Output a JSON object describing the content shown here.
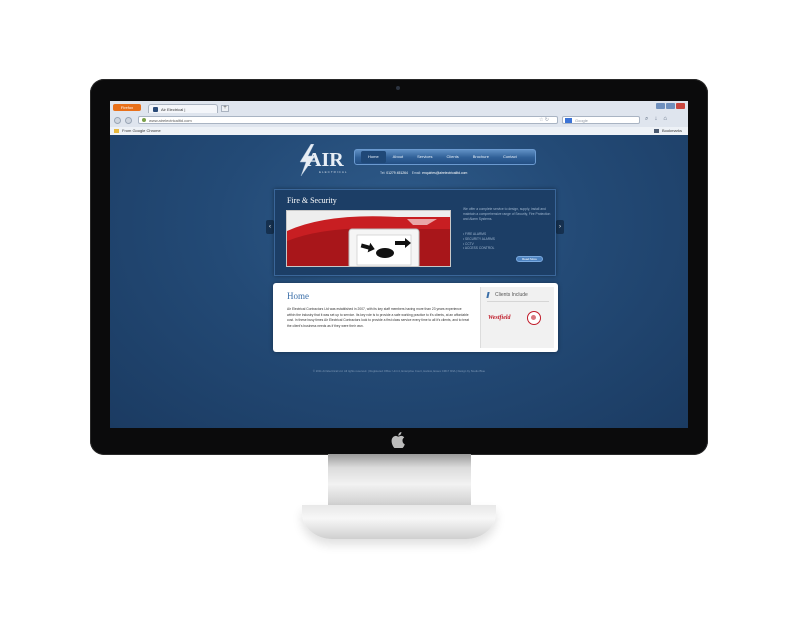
{
  "browser": {
    "app_button": "Firefox",
    "tab_title": "Air Electrical |",
    "url": "www.airelectricalltd.com",
    "search_placeholder": "Google",
    "bookmark_left": "From Google Chrome",
    "bookmark_right": "Bookmarks"
  },
  "site": {
    "logo_text": "AIR",
    "logo_sub": "ELECTRICAL",
    "menu": [
      "Home",
      "About",
      "Services",
      "Clients",
      "Brochure",
      "Contact"
    ],
    "contact": {
      "tel_label": "Tel:",
      "tel": "01279 451264",
      "email_label": "Email:",
      "email": "enquiries@airelectricalltd.com"
    },
    "slide": {
      "title": "Fire & Security",
      "description": "We offer a complete service to design, supply, install and maintain a comprehensive range of Security, Fire Protection and Alarm Systems.",
      "list": [
        "FIRE ALARMS",
        "SECURITY ALARMS",
        "CCTV",
        "ACCESS CONTROL"
      ],
      "read_more": "Read More"
    },
    "home": {
      "title": "Home",
      "text": "Air Electrical Contractors Ltd was established in 2007, with its key staff members having more than 23 years experience within the industry that it was set up to service. Its key role is to provide a safe working practice to it's clients, at an affordable cost. In these busy times Air Electrical Contractors look to provide a first class service every time to all it's clients, and to treat the client's business needs as if they were their own."
    },
    "clients": {
      "heading": "Clients Include",
      "westfield": "Westfield"
    },
    "footer": "© 2011 Air Electrical Ltd. All rights reserved.   |   Registered Office: Unit 4, Enterprise Court, Harlow, Essex CM17 9NA   |   Design by Studio Blue"
  },
  "colors": {
    "accent": "#3a6ea8",
    "brand_red": "#c01c2a",
    "site_bg": "#234a76"
  }
}
